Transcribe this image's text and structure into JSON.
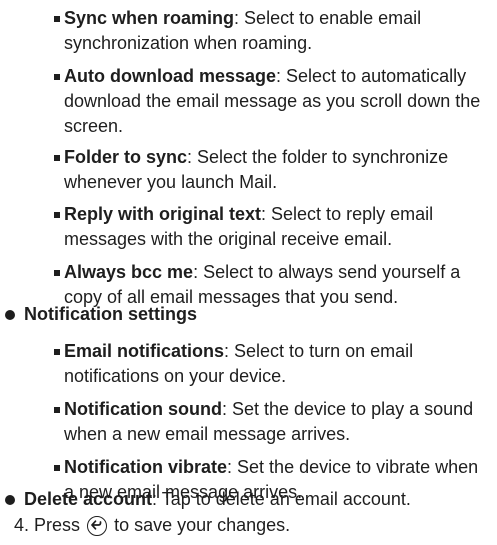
{
  "items": [
    {
      "type": "sub",
      "label": "Sync when roaming",
      "text": ": Select to enable email synchronization when roaming."
    },
    {
      "type": "sub",
      "label": "Auto download message",
      "text": ": Select to automatically download the email message as you scroll down the screen."
    },
    {
      "type": "sub",
      "label": "Folder to sync",
      "text": ": Select the folder to synchronize whenever you launch Mail."
    },
    {
      "type": "sub",
      "label": "Reply with original text",
      "text": ": Select to reply email messages with the original receive email."
    },
    {
      "type": "sub",
      "label": "Always bcc me",
      "text": ": Select to always send yourself a copy of all email messages that you send."
    },
    {
      "type": "main",
      "label": "Notification settings",
      "text": ""
    },
    {
      "type": "sub",
      "label": "Email notifications",
      "text": ": Select to turn on email notifications on your device."
    },
    {
      "type": "sub",
      "label": "Notification sound",
      "text": ": Set the device to play a sound when a new email message arrives."
    },
    {
      "type": "sub",
      "label": "Notification vibrate",
      "text": ": Set the device to vibrate when a new email message arrives."
    },
    {
      "type": "main",
      "label": "Delete account",
      "text": ": Tap to delete an email account."
    }
  ],
  "step": {
    "before": "4. Press",
    "icon": "back-arrow-icon",
    "after": "to save your changes."
  }
}
